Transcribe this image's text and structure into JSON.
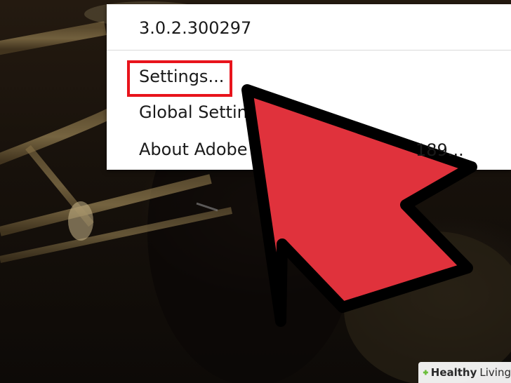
{
  "context_menu": {
    "items": [
      {
        "label": "3.0.2.300297"
      },
      {
        "label": "Settings..."
      },
      {
        "label": "Global Setting"
      },
      {
        "label": "About Adobe F"
      }
    ],
    "trailing_fragment": "189..."
  },
  "annotation": {
    "highlight_color": "#e8141c",
    "arrow_color": "#e0323c"
  },
  "watermark": {
    "brand_word": "Healthy",
    "brand_word2": "Living",
    "accent_color": "#6cbf3c"
  }
}
